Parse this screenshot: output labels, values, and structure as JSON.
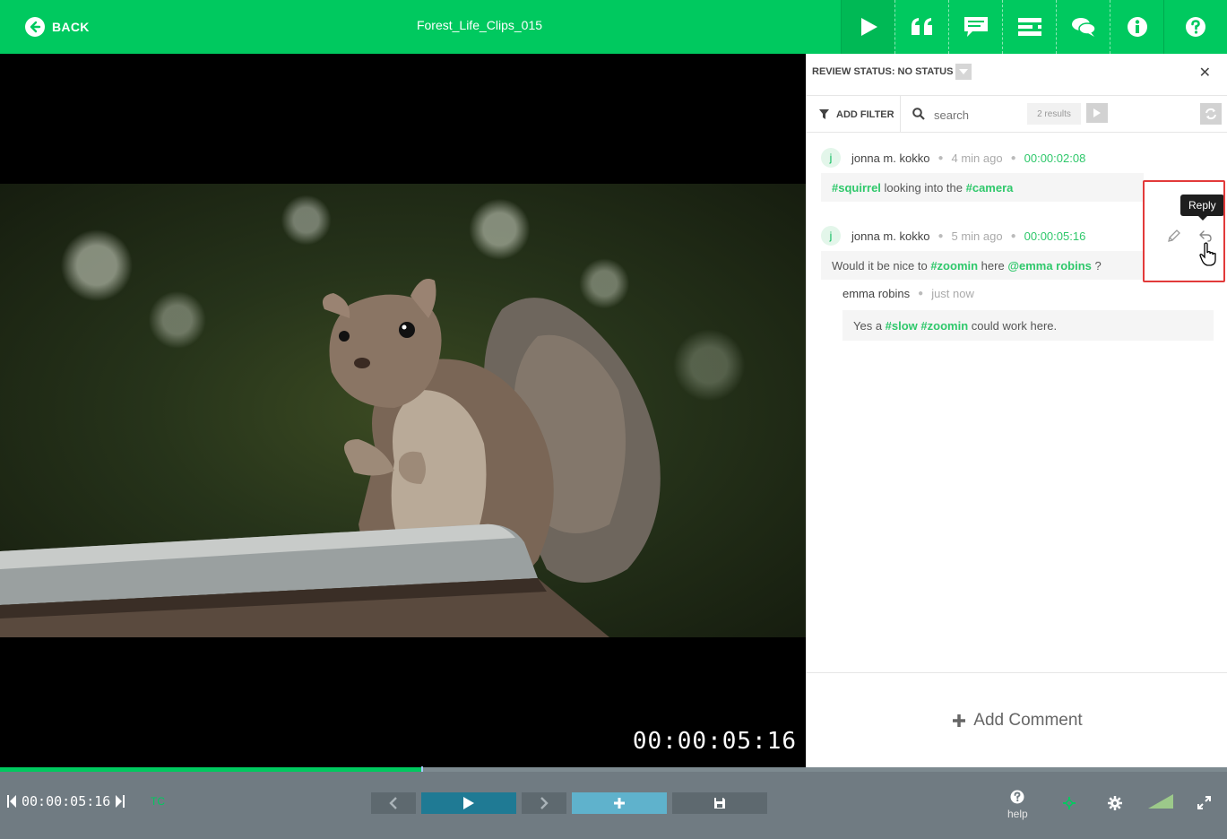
{
  "header": {
    "back_label": "BACK",
    "title": "Forest_Life_Clips_015"
  },
  "video": {
    "timecode": "00:00:05:16"
  },
  "panel": {
    "review_status": "REVIEW STATUS: NO STATUS",
    "add_filter_label": "ADD FILTER",
    "search_placeholder": "search",
    "results": "2 results",
    "comments": [
      {
        "avatar": "j",
        "author": "jonna m. kokko",
        "ago": "4 min ago",
        "timecode": "00:00:02:08",
        "tag1": "#squirrel",
        "text1": " looking into the ",
        "tag2": "#camera"
      },
      {
        "avatar": "j",
        "author": "jonna m. kokko",
        "ago": "5 min ago",
        "timecode": "00:00:05:16",
        "text1": "Would it be nice to ",
        "tag1": "#zoomin",
        "text2": " here ",
        "mention": "@emma robins",
        "text3": " ?",
        "reply": {
          "author": "emma robins",
          "ago": "just now",
          "text1": "Yes a ",
          "tag1": "#slow",
          "tag2": "#zoomin",
          "text2": " could work here."
        }
      }
    ],
    "tooltip": "Reply",
    "add_comment_label": "Add Comment"
  },
  "player": {
    "timecode": "00:00:05:16",
    "tc_label": "TC",
    "help_label": "help",
    "progress_fraction": 0.343
  },
  "colors": {
    "brand_green": "#00c95f",
    "tag_green": "#2fc86b",
    "bottom_bar": "#707b82",
    "play_button": "#1f7a94",
    "add_button": "#5fb2cc",
    "highlight": "#e23a3a"
  }
}
